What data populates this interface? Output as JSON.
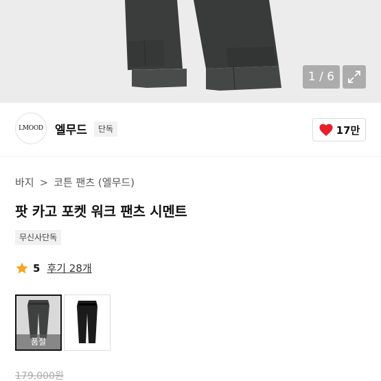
{
  "gallery": {
    "counter": "1 / 6",
    "expand_icon": "expand-icon"
  },
  "brand": {
    "logo_text": "LMOOD",
    "name": "엘무드",
    "tag": "단독",
    "like_count": "17만",
    "like_color": "#e8202a"
  },
  "breadcrumb": {
    "category": "바지",
    "separator": ">",
    "subcategory": "코튼 팬츠 (엘무드)"
  },
  "product": {
    "title": "팟 카고 포켓 워크 팬츠 시멘트",
    "exclusive_badge": "무신사단독",
    "rating": "5",
    "reviews": "후기 28개",
    "star_color": "#f5a623",
    "original_price": "179,000원"
  },
  "options": [
    {
      "name": "cement",
      "status": "품절",
      "selected": true
    },
    {
      "name": "black",
      "status": "",
      "selected": false
    }
  ]
}
